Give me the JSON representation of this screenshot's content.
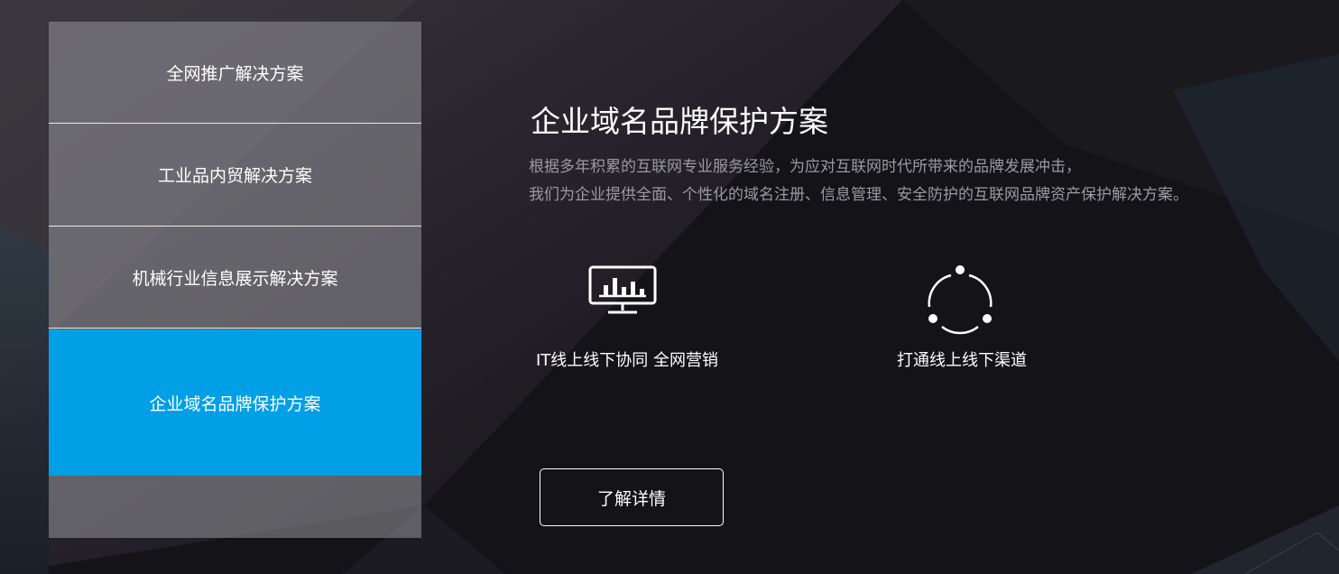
{
  "menu": {
    "items": [
      {
        "label": "全网推广解决方案"
      },
      {
        "label": "工业品内贸解决方案"
      },
      {
        "label": "机械行业信息展示解决方案"
      },
      {
        "label": "企业域名品牌保护方案",
        "active": true
      }
    ]
  },
  "main": {
    "title": "企业域名品牌保护方案",
    "description": [
      "根据多年积累的互联网专业服务经验，为应对互联网时代所带来的品牌发展冲击，",
      "我们为企业提供全面、个性化的域名注册、信息管理、安全防护的互联网品牌资产保护解决方案。"
    ],
    "features": [
      {
        "icon": "monitor-chart-icon",
        "label": "IT线上线下协同 全网营销"
      },
      {
        "icon": "cycle-network-icon",
        "label": "打通线上线下渠道"
      }
    ],
    "cta_label": "了解详情"
  },
  "colors": {
    "active": "#019fe6",
    "background": "#141318",
    "description_text": "#9a9aa0"
  }
}
